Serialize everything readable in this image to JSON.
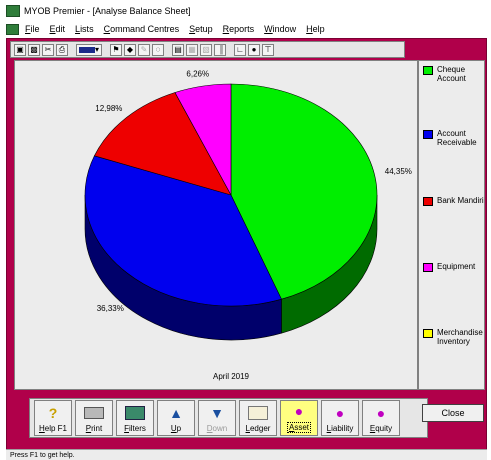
{
  "window": {
    "title": "MYOB Premier - [Analyse Balance Sheet]"
  },
  "menu": {
    "items": [
      "File",
      "Edit",
      "Lists",
      "Command Centres",
      "Setup",
      "Reports",
      "Window",
      "Help"
    ]
  },
  "toolbar": {
    "buttons": [
      "save-icon",
      "print-preview-icon",
      "cut-icon",
      "print-icon",
      "color-bar-icon",
      "car-icon",
      "diamond-icon",
      "pencil-icon",
      "zoom-icon",
      "page-icon",
      "grid-icon",
      "table-icon",
      "bar-icon",
      "chart-axis-icon",
      "find-icon",
      "tool-icon"
    ]
  },
  "chart_data": {
    "type": "pie",
    "title": "",
    "caption": "April 2019",
    "slices": [
      {
        "label": "Cheque Account",
        "value": 44.35,
        "display": "44,35%",
        "color": "#00ee00"
      },
      {
        "label": "Account Receivable",
        "value": 36.33,
        "display": "36,33%",
        "color": "#0000ee"
      },
      {
        "label": "Bank Mandiri",
        "value": 12.98,
        "display": "12,98%",
        "color": "#ee0000"
      },
      {
        "label": "Equipment",
        "value": 6.26,
        "display": "6,26%",
        "color": "#ff00ff"
      },
      {
        "label": "Merchandise Inventory",
        "value": 0,
        "display": "",
        "color": "#ffff00"
      }
    ]
  },
  "legend": {
    "items": [
      {
        "label": "Cheque Account",
        "color": "#00ee00"
      },
      {
        "label": "Account Receivable",
        "color": "#0000ee"
      },
      {
        "label": "Bank Mandiri",
        "color": "#ee0000"
      },
      {
        "label": "Equipment",
        "color": "#ff00ff"
      },
      {
        "label": "Merchandise Inventory",
        "color": "#ffff00"
      }
    ]
  },
  "buttons": {
    "help": "Help F1",
    "print": "Print",
    "filters": "Filters",
    "up": "Up",
    "down": "Down",
    "ledger": "Ledger",
    "asset": "Asset",
    "liability": "Liability",
    "equity": "Equity",
    "close": "Close"
  },
  "status": {
    "text": "Press F1 to get help."
  }
}
